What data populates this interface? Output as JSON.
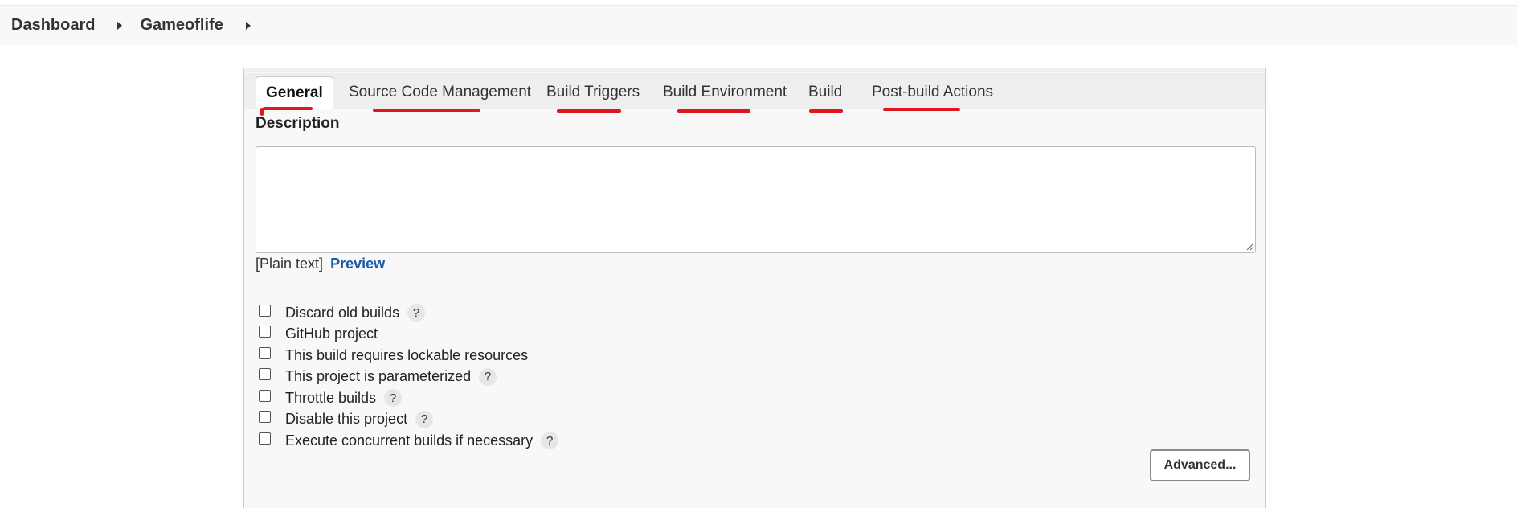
{
  "breadcrumb": {
    "items": [
      {
        "label": "Dashboard"
      },
      {
        "label": "Gameoflife"
      }
    ]
  },
  "tabs": [
    {
      "label": "General",
      "active": true
    },
    {
      "label": "Source Code Management",
      "active": false
    },
    {
      "label": "Build Triggers",
      "active": false
    },
    {
      "label": "Build Environment",
      "active": false
    },
    {
      "label": "Build",
      "active": false
    },
    {
      "label": "Post-build Actions",
      "active": false
    }
  ],
  "annotation_color": "#e0161f",
  "description": {
    "label": "Description",
    "value": "",
    "format_text": "[Plain text]",
    "preview_link": "Preview"
  },
  "options": [
    {
      "label": "Discard old builds",
      "checked": false,
      "help": "?"
    },
    {
      "label": "GitHub project",
      "checked": false,
      "help": null
    },
    {
      "label": "This build requires lockable resources",
      "checked": false,
      "help": null
    },
    {
      "label": "This project is parameterized",
      "checked": false,
      "help": "?"
    },
    {
      "label": "Throttle builds",
      "checked": false,
      "help": "?"
    },
    {
      "label": "Disable this project",
      "checked": false,
      "help": "?"
    },
    {
      "label": "Execute concurrent builds if necessary",
      "checked": false,
      "help": "?"
    }
  ],
  "advanced_button": {
    "label": "Advanced..."
  }
}
